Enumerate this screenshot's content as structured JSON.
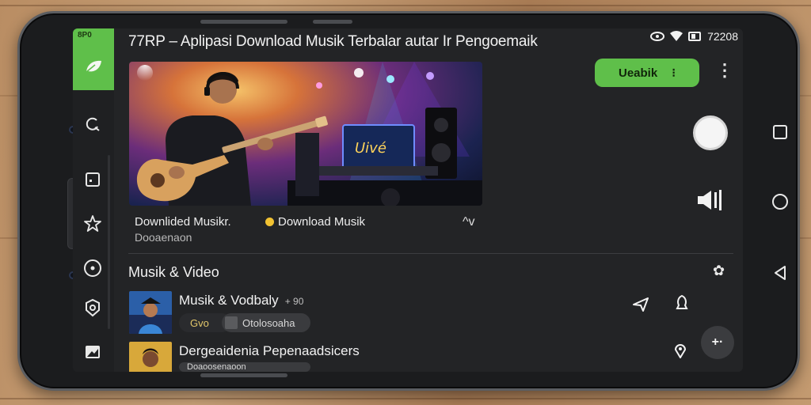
{
  "app": {
    "title": "77RP – Aplipasi Download Musik Terbalar autar Ir Pengoemaik",
    "status_time": "72208",
    "status_corner": "8P0"
  },
  "toolbar": {
    "primary_button": "Ueabik",
    "primary_button_dots": "⁝"
  },
  "hero": {
    "caption_left": "Downlided Musikr.",
    "caption_right": "Download Musik",
    "caption_sub": "Dooaenaon",
    "expand_glyph": "^v"
  },
  "section": {
    "title": "Musik & Video"
  },
  "list": [
    {
      "title": "Musik & Vodbaly",
      "meta": "+ 90",
      "tag_left": "Gvo",
      "tag_right": "Otolosoaha"
    },
    {
      "title": "Dergeaidenia Pepenaadsicers",
      "tag": "Doaoosenaoon"
    }
  ],
  "icons": {
    "rail": [
      "leaf-icon",
      "refresh-icon",
      "note-icon",
      "star-icon",
      "record-icon",
      "badge-icon",
      "image-icon"
    ],
    "right": [
      "camera-shutter-icon",
      "volume-icon",
      "settings-icon",
      "share-icon",
      "bell-icon",
      "location-icon",
      "add-icon"
    ],
    "nav": [
      "square-nav-icon",
      "circle-nav-icon",
      "back-nav-icon"
    ]
  },
  "colors": {
    "accent_green": "#5fbf4a",
    "screen_bg": "#232426",
    "phone_body": "#1b1c1e"
  }
}
